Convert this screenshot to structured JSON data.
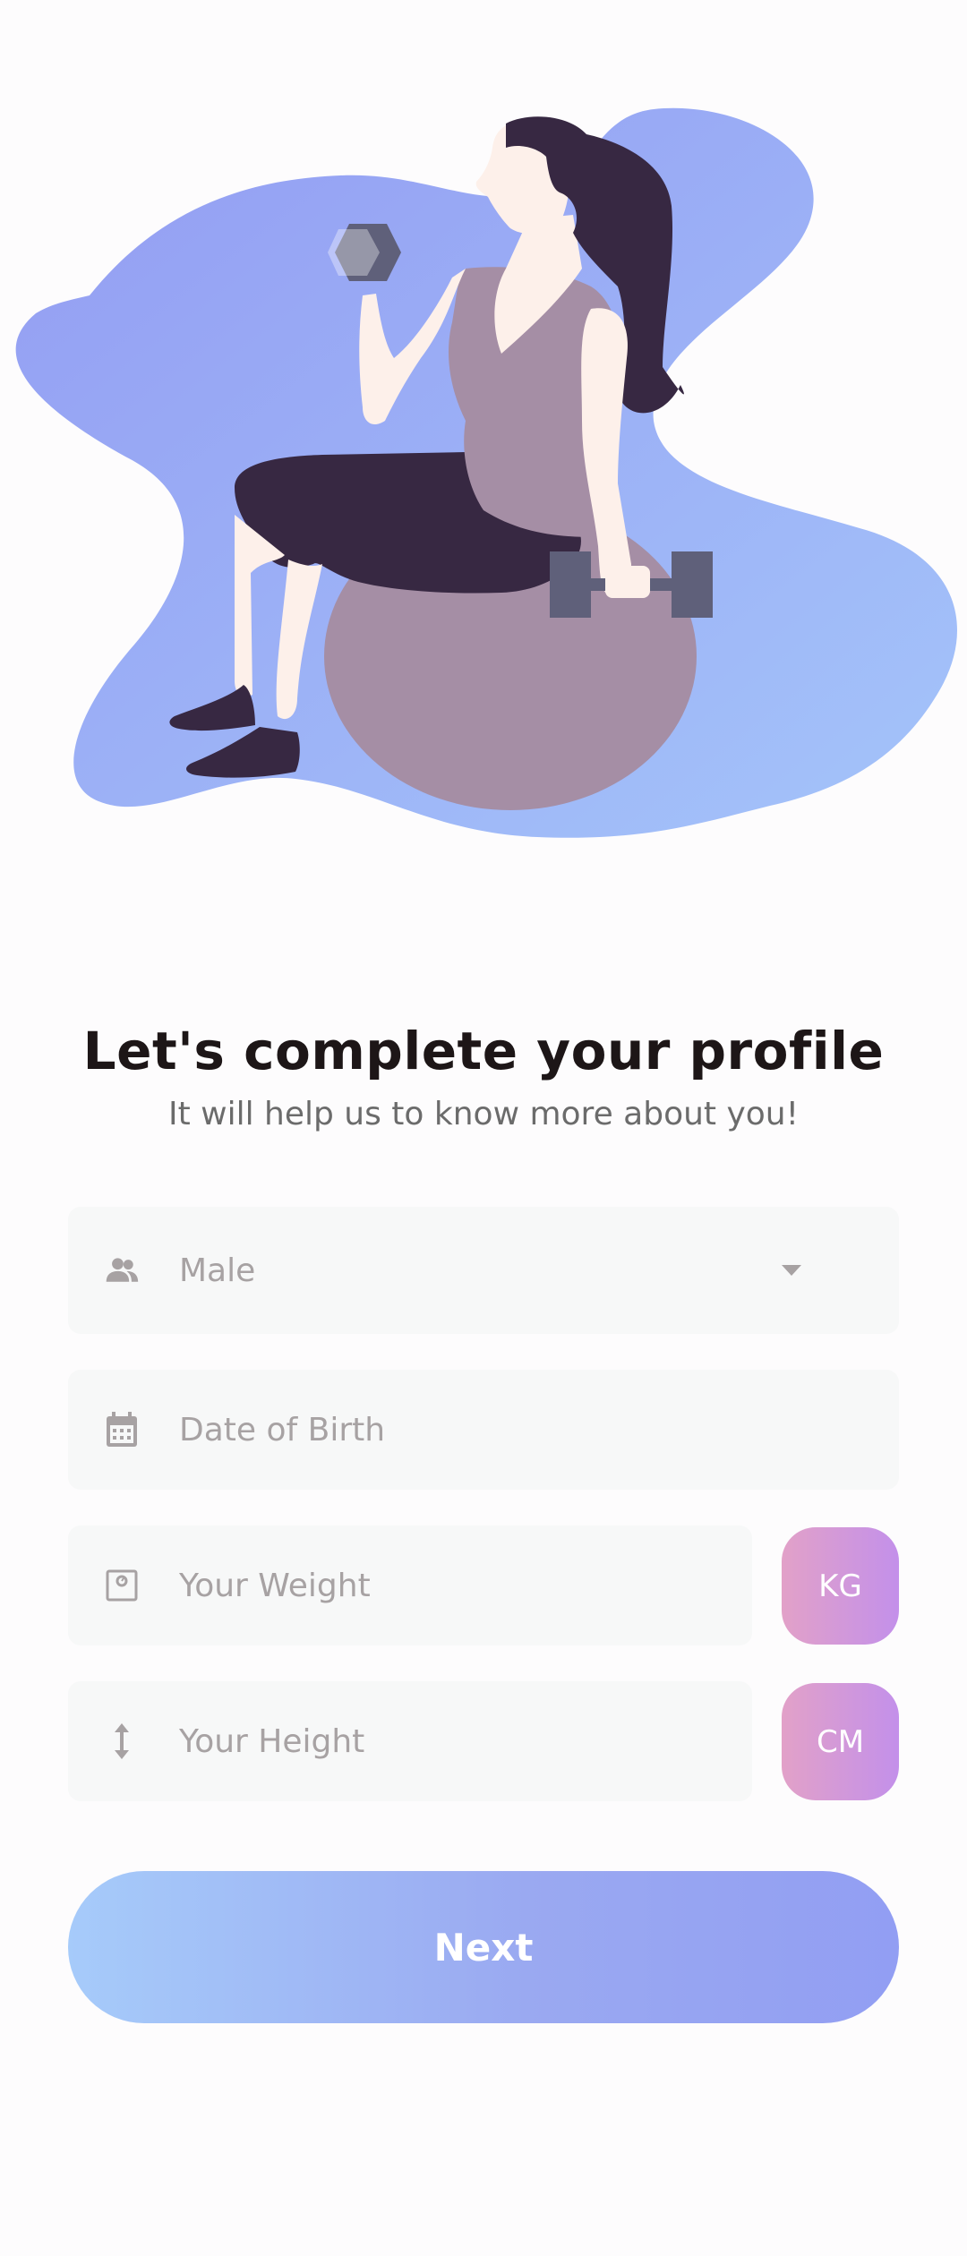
{
  "header": {
    "title": "Let's complete your profile",
    "subtitle": "It will help us to know more about you!"
  },
  "form": {
    "gender": {
      "value": "Male",
      "icon": "users-icon"
    },
    "dob": {
      "placeholder": "Date of Birth",
      "icon": "calendar-icon"
    },
    "weight": {
      "placeholder": "Your Weight",
      "icon": "scale-icon",
      "unit": "KG"
    },
    "height": {
      "placeholder": "Your Height",
      "icon": "height-arrows-icon",
      "unit": "CM"
    }
  },
  "actions": {
    "next_label": "Next"
  },
  "colors": {
    "blob_start": "#939cf2",
    "blob_end": "#a4c4fa",
    "unit_start": "#e2a1c8",
    "unit_end": "#c390ea",
    "button_start": "#a6cbfa",
    "button_end": "#929ef3"
  }
}
